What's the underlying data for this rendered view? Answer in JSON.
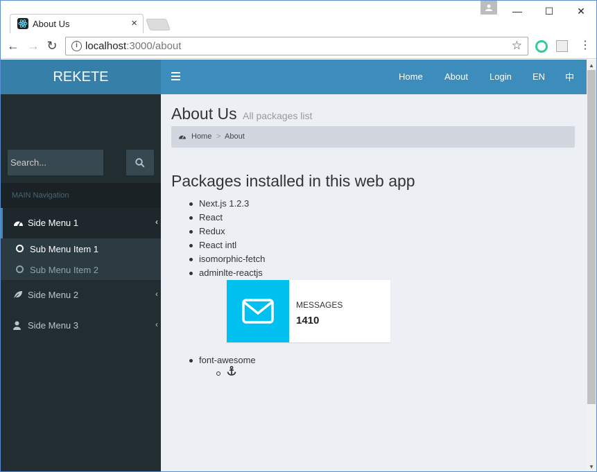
{
  "browser": {
    "tab_title": "About Us",
    "tab_close": "×",
    "url_host": "localhost",
    "url_path": ":3000/about",
    "window_controls": {
      "minimize": "—",
      "maximize": "☐",
      "close": "✕"
    }
  },
  "sidebar": {
    "logo": "REKETE",
    "search_placeholder": "Search...",
    "nav_header": "MAIN Navigation",
    "menus": [
      {
        "label": "Side Menu 1",
        "icon": "dashboard-icon",
        "expanded": true,
        "items": [
          {
            "label": "Sub Menu Item 1",
            "active": true
          },
          {
            "label": "Sub Menu Item 2",
            "active": false
          }
        ]
      },
      {
        "label": "Side Menu 2",
        "icon": "leaf-icon"
      },
      {
        "label": "Side Menu 3",
        "icon": "user-icon"
      }
    ]
  },
  "header": {
    "nav": [
      "Home",
      "About",
      "Login",
      "EN",
      "中"
    ]
  },
  "content": {
    "title": "About Us",
    "subtitle": "All packages list",
    "breadcrumb": {
      "home": "Home",
      "separator": ">",
      "current": "About"
    },
    "heading": "Packages installed in this web app",
    "packages": [
      "Next.js 1.2.3",
      "React",
      "Redux",
      "React intl",
      "isomorphic-fetch",
      "adminlte-reactjs"
    ],
    "infobox": {
      "label": "MESSAGES",
      "value": "1410",
      "color": "#00c0ef",
      "icon": "envelope-icon"
    },
    "last_package": "font-awesome",
    "sub_item_icon": "anchor-icon"
  },
  "colors": {
    "header": "#3c8dbc",
    "logo": "#367fa9",
    "sidebar": "#222d32",
    "page": "#ecf0f5"
  }
}
